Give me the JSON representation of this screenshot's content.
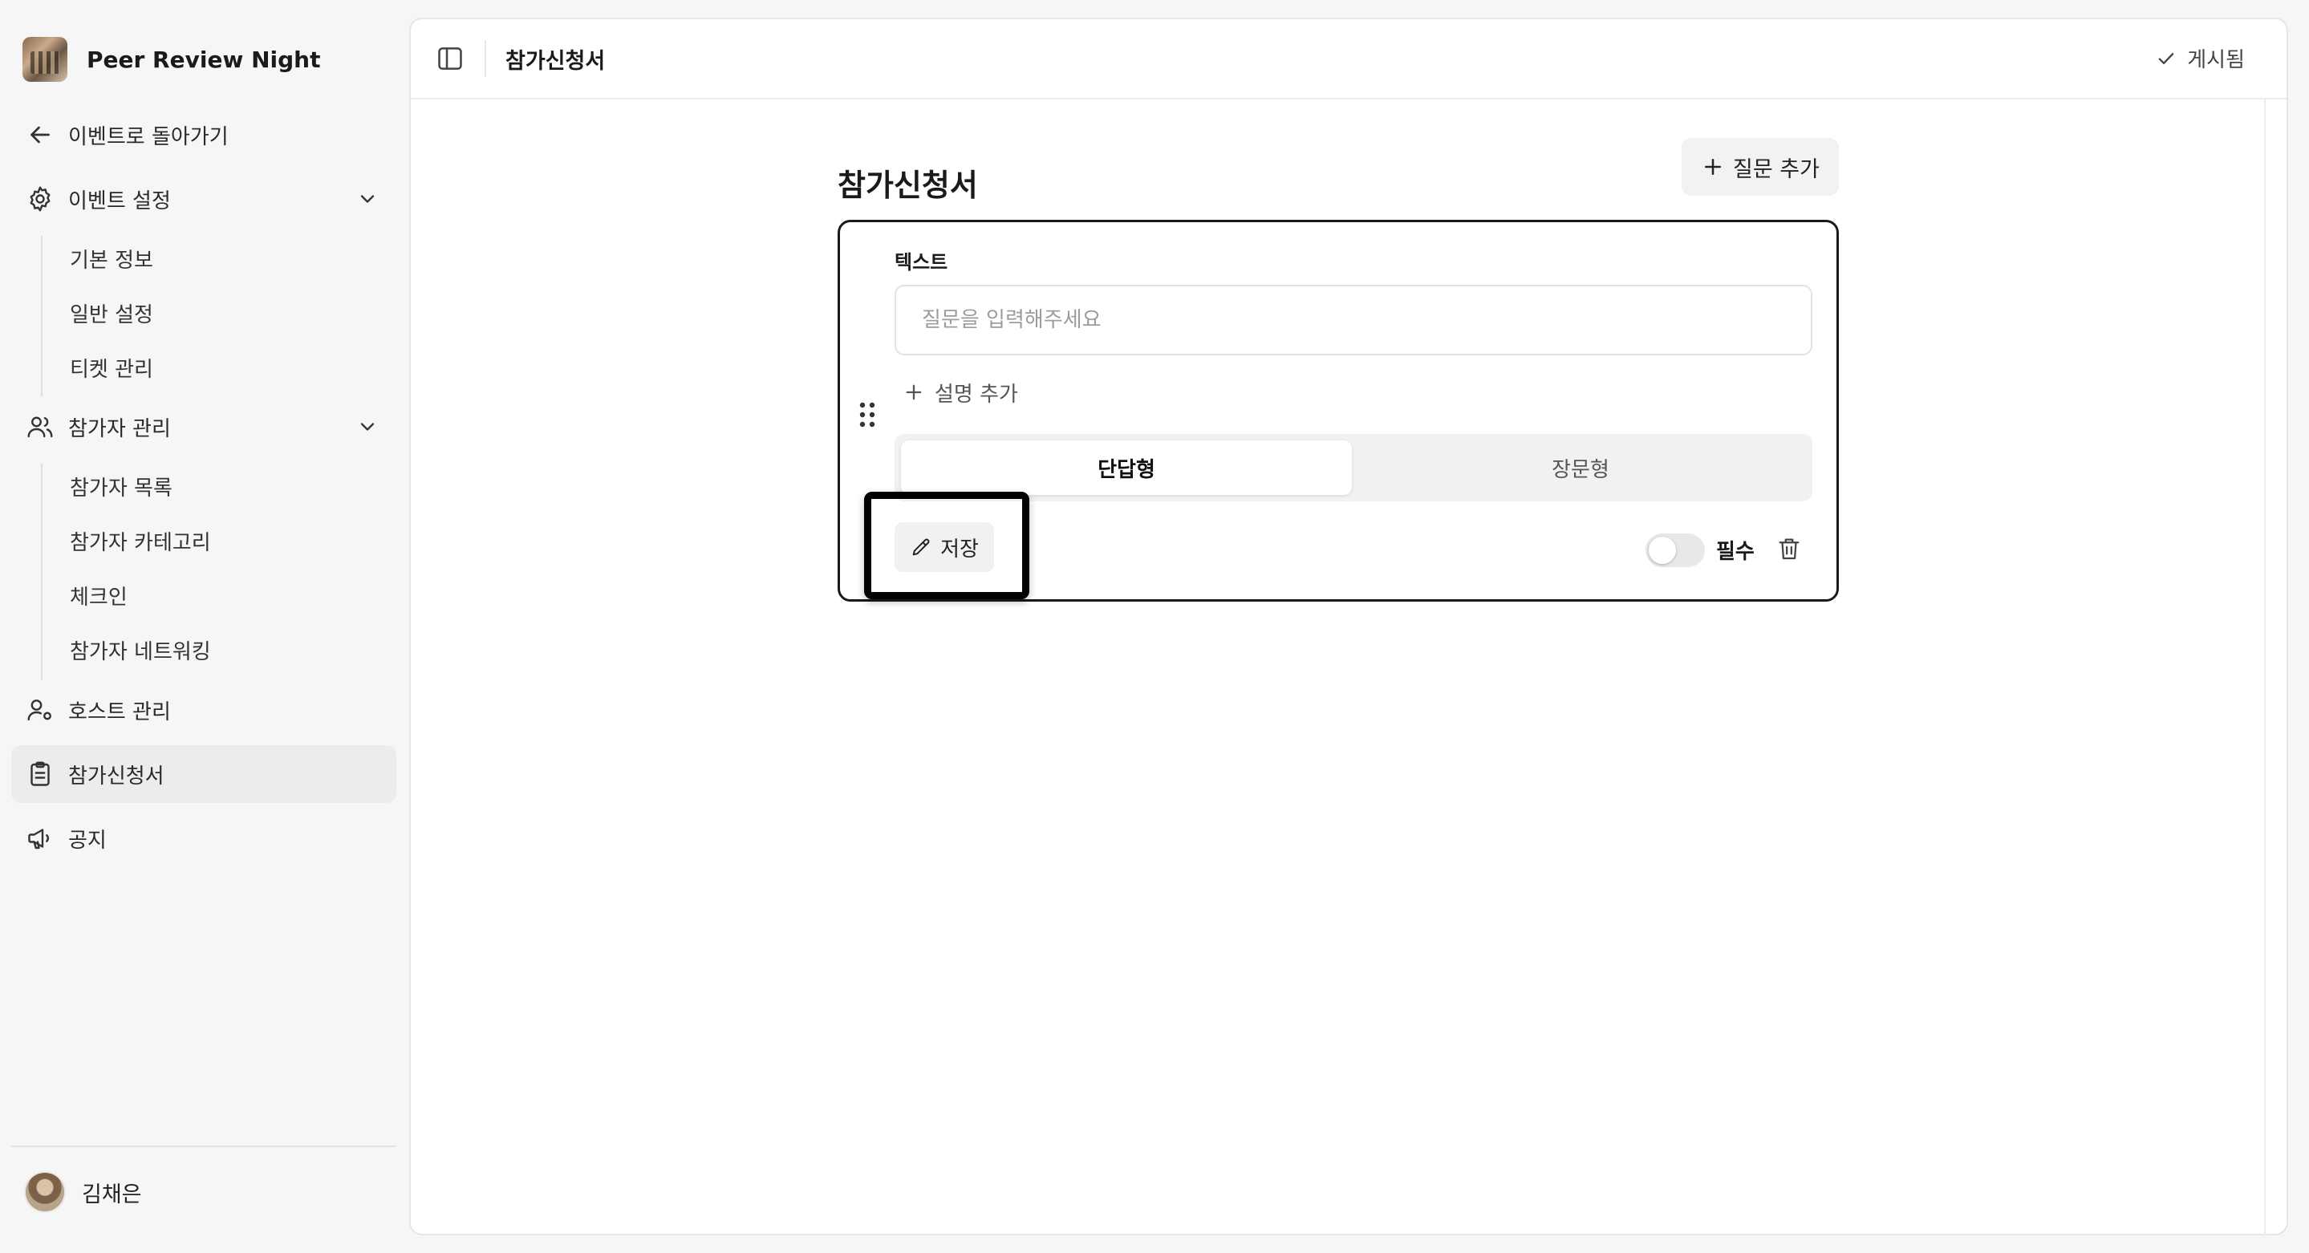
{
  "event": {
    "name": "Peer Review Night"
  },
  "sidebar": {
    "back_label": "이벤트로 돌아가기",
    "event_settings": {
      "label": "이벤트 설정",
      "items": [
        "기본 정보",
        "일반 설정",
        "티켓 관리"
      ]
    },
    "attendees": {
      "label": "참가자 관리",
      "items": [
        "참가자 목록",
        "참가자 카테고리",
        "체크인",
        "참가자 네트워킹"
      ]
    },
    "hosts_label": "호스트 관리",
    "application_label": "참가신청서",
    "notice_label": "공지"
  },
  "user": {
    "name": "김채은"
  },
  "topbar": {
    "title": "참가신청서",
    "status": "게시됨"
  },
  "form": {
    "title": "참가신청서",
    "add_question_label": "질문 추가",
    "question": {
      "type_label": "텍스트",
      "value": "",
      "placeholder": "질문을 입력해주세요",
      "add_description_label": "설명 추가",
      "answer_types": [
        "단답형",
        "장문형"
      ],
      "selected_answer_type": "단답형",
      "save_label": "저장",
      "required_label": "필수",
      "required": false
    }
  }
}
